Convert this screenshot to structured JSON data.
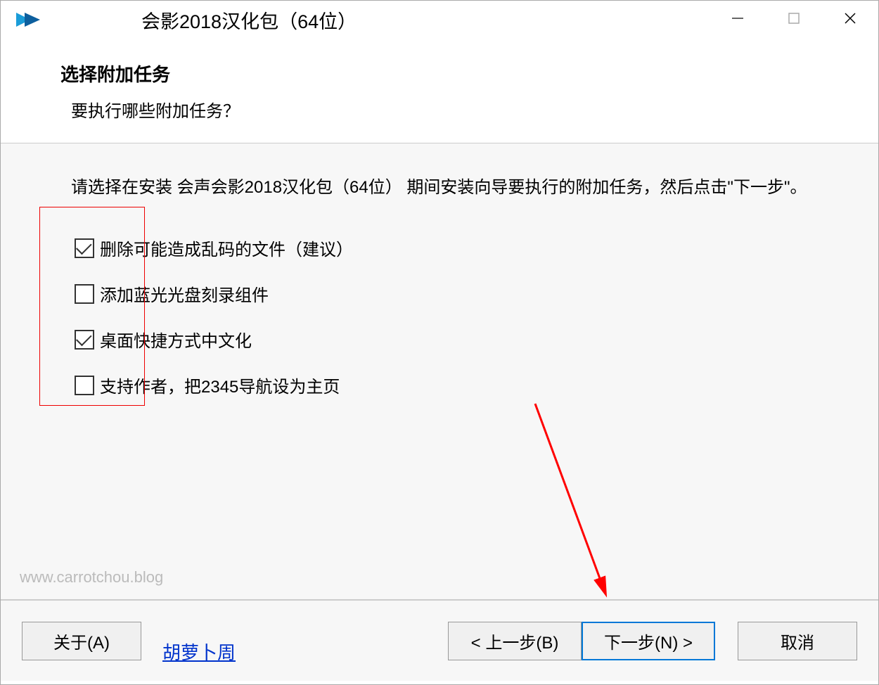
{
  "titlebar": {
    "title": "会影2018汉化包（64位）"
  },
  "header": {
    "title": "选择附加任务",
    "subtitle": "要执行哪些附加任务？"
  },
  "content": {
    "instruction": "请选择在安装 会声会影2018汉化包（64位） 期间安装向导要执行的附加任务，然后点击\"下一步\"。",
    "checkboxes": [
      {
        "label": "删除可能造成乱码的文件（建议）",
        "checked": true
      },
      {
        "label": "添加蓝光光盘刻录组件",
        "checked": false
      },
      {
        "label": "桌面快捷方式中文化",
        "checked": true
      },
      {
        "label": "支持作者，把2345导航设为主页",
        "checked": false
      }
    ]
  },
  "watermark": "www.carrotchou.blog",
  "footer": {
    "about": "关于(A)",
    "author_link": "胡萝卜周",
    "back": "< 上一步(B)",
    "next": "下一步(N) >",
    "cancel": "取消"
  }
}
